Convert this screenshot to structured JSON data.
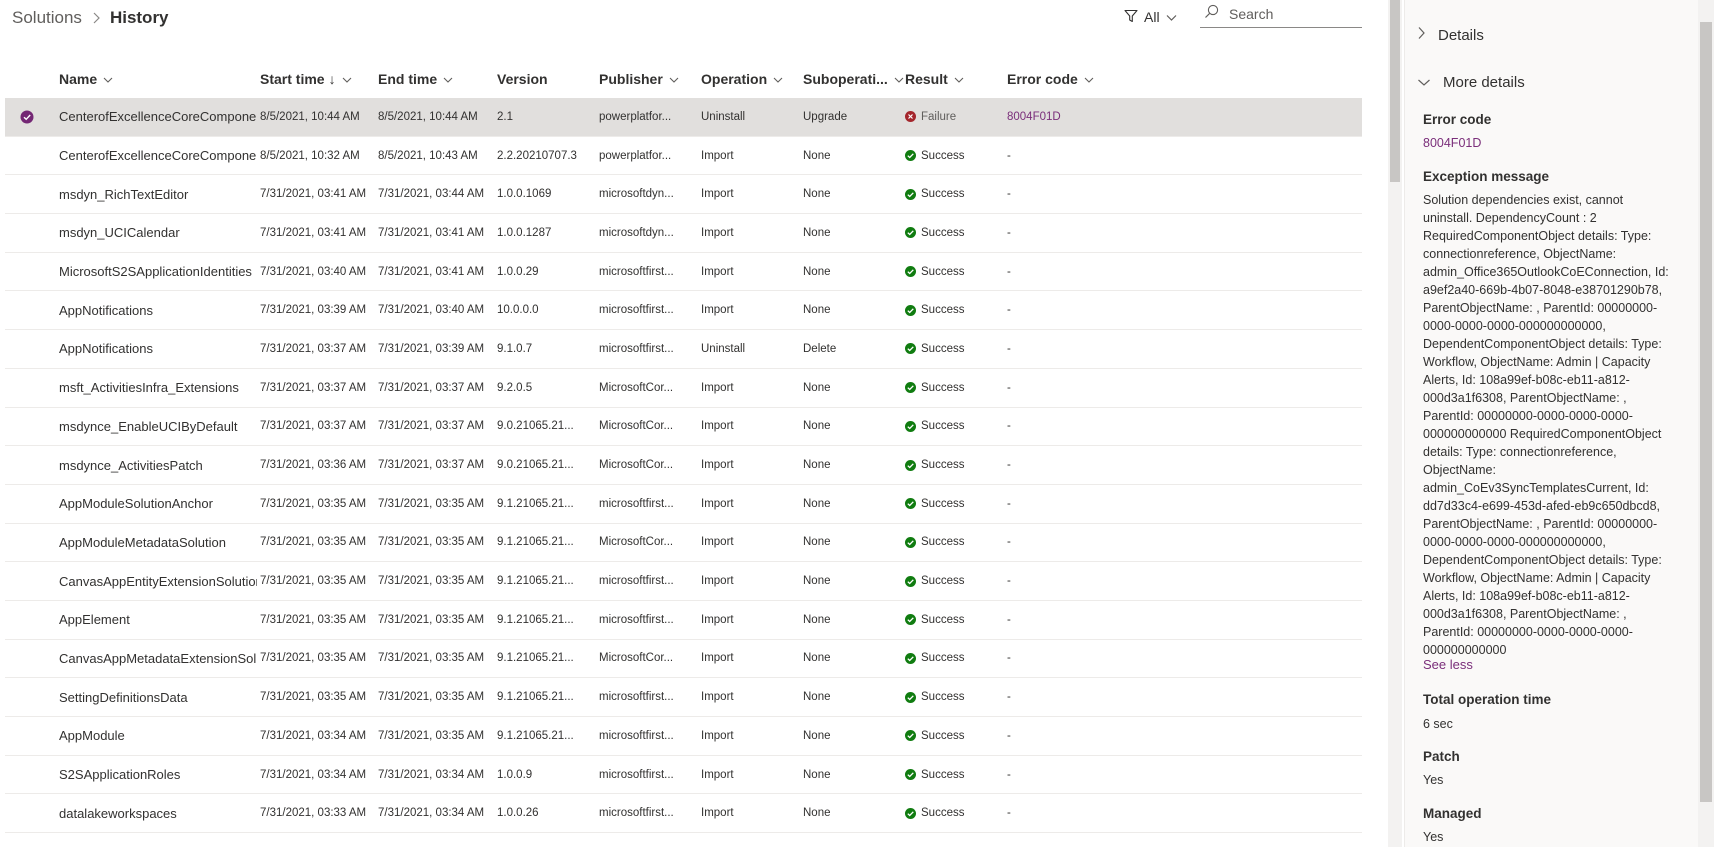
{
  "breadcrumb": {
    "root": "Solutions",
    "current": "History"
  },
  "filter": {
    "label": "All"
  },
  "search": {
    "placeholder": "Search"
  },
  "columns": {
    "name": "Name",
    "start_time": "Start time",
    "start_sort": "↓",
    "end_time": "End time",
    "version": "Version",
    "publisher": "Publisher",
    "operation": "Operation",
    "suboperation": "Suboperati...",
    "result": "Result",
    "error_code": "Error code"
  },
  "rows": [
    {
      "name": "CenterofExcellenceCoreComponents",
      "start": "8/5/2021, 10:44 AM",
      "end": "8/5/2021, 10:44 AM",
      "version": "2.1",
      "publisher": "powerplatfor...",
      "operation": "Uninstall",
      "suboperation": "Upgrade",
      "result": "Failure",
      "error": "8004F01D"
    },
    {
      "name": "CenterofExcellenceCoreComponents",
      "start": "8/5/2021, 10:32 AM",
      "end": "8/5/2021, 10:43 AM",
      "version": "2.2.20210707.3",
      "publisher": "powerplatfor...",
      "operation": "Import",
      "suboperation": "None",
      "result": "Success",
      "error": "-"
    },
    {
      "name": "msdyn_RichTextEditor",
      "start": "7/31/2021, 03:41 AM",
      "end": "7/31/2021, 03:44 AM",
      "version": "1.0.0.1069",
      "publisher": "microsoftdyn...",
      "operation": "Import",
      "suboperation": "None",
      "result": "Success",
      "error": "-"
    },
    {
      "name": "msdyn_UCICalendar",
      "start": "7/31/2021, 03:41 AM",
      "end": "7/31/2021, 03:41 AM",
      "version": "1.0.0.1287",
      "publisher": "microsoftdyn...",
      "operation": "Import",
      "suboperation": "None",
      "result": "Success",
      "error": "-"
    },
    {
      "name": "MicrosoftS2SApplicationIdentities",
      "start": "7/31/2021, 03:40 AM",
      "end": "7/31/2021, 03:41 AM",
      "version": "1.0.0.29",
      "publisher": "microsoftfirst...",
      "operation": "Import",
      "suboperation": "None",
      "result": "Success",
      "error": "-"
    },
    {
      "name": "AppNotifications",
      "start": "7/31/2021, 03:39 AM",
      "end": "7/31/2021, 03:40 AM",
      "version": "10.0.0.0",
      "publisher": "microsoftfirst...",
      "operation": "Import",
      "suboperation": "None",
      "result": "Success",
      "error": "-"
    },
    {
      "name": "AppNotifications",
      "start": "7/31/2021, 03:37 AM",
      "end": "7/31/2021, 03:39 AM",
      "version": "9.1.0.7",
      "publisher": "microsoftfirst...",
      "operation": "Uninstall",
      "suboperation": "Delete",
      "result": "Success",
      "error": "-"
    },
    {
      "name": "msft_ActivitiesInfra_Extensions",
      "start": "7/31/2021, 03:37 AM",
      "end": "7/31/2021, 03:37 AM",
      "version": "9.2.0.5",
      "publisher": "MicrosoftCor...",
      "operation": "Import",
      "suboperation": "None",
      "result": "Success",
      "error": "-"
    },
    {
      "name": "msdynce_EnableUCIByDefault",
      "start": "7/31/2021, 03:37 AM",
      "end": "7/31/2021, 03:37 AM",
      "version": "9.0.21065.21...",
      "publisher": "MicrosoftCor...",
      "operation": "Import",
      "suboperation": "None",
      "result": "Success",
      "error": "-"
    },
    {
      "name": "msdynce_ActivitiesPatch",
      "start": "7/31/2021, 03:36 AM",
      "end": "7/31/2021, 03:37 AM",
      "version": "9.0.21065.21...",
      "publisher": "MicrosoftCor...",
      "operation": "Import",
      "suboperation": "None",
      "result": "Success",
      "error": "-"
    },
    {
      "name": "AppModuleSolutionAnchor",
      "start": "7/31/2021, 03:35 AM",
      "end": "7/31/2021, 03:35 AM",
      "version": "9.1.21065.21...",
      "publisher": "microsoftfirst...",
      "operation": "Import",
      "suboperation": "None",
      "result": "Success",
      "error": "-"
    },
    {
      "name": "AppModuleMetadataSolution",
      "start": "7/31/2021, 03:35 AM",
      "end": "7/31/2021, 03:35 AM",
      "version": "9.1.21065.21...",
      "publisher": "MicrosoftCor...",
      "operation": "Import",
      "suboperation": "None",
      "result": "Success",
      "error": "-"
    },
    {
      "name": "CanvasAppEntityExtensionSolution",
      "start": "7/31/2021, 03:35 AM",
      "end": "7/31/2021, 03:35 AM",
      "version": "9.1.21065.21...",
      "publisher": "microsoftfirst...",
      "operation": "Import",
      "suboperation": "None",
      "result": "Success",
      "error": "-"
    },
    {
      "name": "AppElement",
      "start": "7/31/2021, 03:35 AM",
      "end": "7/31/2021, 03:35 AM",
      "version": "9.1.21065.21...",
      "publisher": "microsoftfirst...",
      "operation": "Import",
      "suboperation": "None",
      "result": "Success",
      "error": "-"
    },
    {
      "name": "CanvasAppMetadataExtensionSolutior",
      "start": "7/31/2021, 03:35 AM",
      "end": "7/31/2021, 03:35 AM",
      "version": "9.1.21065.21...",
      "publisher": "MicrosoftCor...",
      "operation": "Import",
      "suboperation": "None",
      "result": "Success",
      "error": "-"
    },
    {
      "name": "SettingDefinitionsData",
      "start": "7/31/2021, 03:35 AM",
      "end": "7/31/2021, 03:35 AM",
      "version": "9.1.21065.21...",
      "publisher": "microsoftfirst...",
      "operation": "Import",
      "suboperation": "None",
      "result": "Success",
      "error": "-"
    },
    {
      "name": "AppModule",
      "start": "7/31/2021, 03:34 AM",
      "end": "7/31/2021, 03:35 AM",
      "version": "9.1.21065.21...",
      "publisher": "microsoftfirst...",
      "operation": "Import",
      "suboperation": "None",
      "result": "Success",
      "error": "-"
    },
    {
      "name": "S2SApplicationRoles",
      "start": "7/31/2021, 03:34 AM",
      "end": "7/31/2021, 03:34 AM",
      "version": "1.0.0.9",
      "publisher": "microsoftfirst...",
      "operation": "Import",
      "suboperation": "None",
      "result": "Success",
      "error": "-"
    },
    {
      "name": "datalakeworkspaces",
      "start": "7/31/2021, 03:33 AM",
      "end": "7/31/2021, 03:34 AM",
      "version": "1.0.0.26",
      "publisher": "microsoftfirst...",
      "operation": "Import",
      "suboperation": "None",
      "result": "Success",
      "error": "-"
    }
  ],
  "panel": {
    "details_label": "Details",
    "more_details_label": "More details",
    "error_code_label": "Error code",
    "error_code_value": "8004F01D",
    "exception_label": "Exception message",
    "exception_text": "Solution dependencies exist, cannot uninstall. DependencyCount : 2 RequiredComponentObject details: Type: connectionreference, ObjectName: admin_Office365OutlookCoEConnection, Id: a9ef2a40-669b-4b07-8048-e38701290b78, ParentObjectName: , ParentId: 00000000-0000-0000-0000-000000000000, DependentComponentObject details: Type: Workflow, ObjectName: Admin | Capacity Alerts, Id: 108a99ef-b08c-eb11-a812-000d3a1f6308, ParentObjectName: , ParentId: 00000000-0000-0000-0000-000000000000 RequiredComponentObject details: Type: connectionreference, ObjectName: admin_CoEv3SyncTemplatesCurrent, Id: dd7d33c4-e699-453d-afed-eb9c650dbcd8, ParentObjectName: , ParentId: 00000000-0000-0000-0000-000000000000, DependentComponentObject details: Type: Workflow, ObjectName: Admin | Capacity Alerts, Id: 108a99ef-b08c-eb11-a812-000d3a1f6308, ParentObjectName: , ParentId: 00000000-0000-0000-0000-000000000000",
    "see_less": "See less",
    "total_time_label": "Total operation time",
    "total_time_value": "6 sec",
    "patch_label": "Patch",
    "patch_value": "Yes",
    "managed_label": "Managed",
    "managed_value": "Yes"
  },
  "colors": {
    "accent": "#742774",
    "success": "#107c10",
    "failure": "#a4262c",
    "selected_row": "#e1dfdd"
  },
  "icons": {
    "filter": "filter-icon",
    "search": "search-icon",
    "success": "checkmark-circle-icon",
    "failure": "error-circle-icon",
    "selected": "check-circle-icon"
  }
}
